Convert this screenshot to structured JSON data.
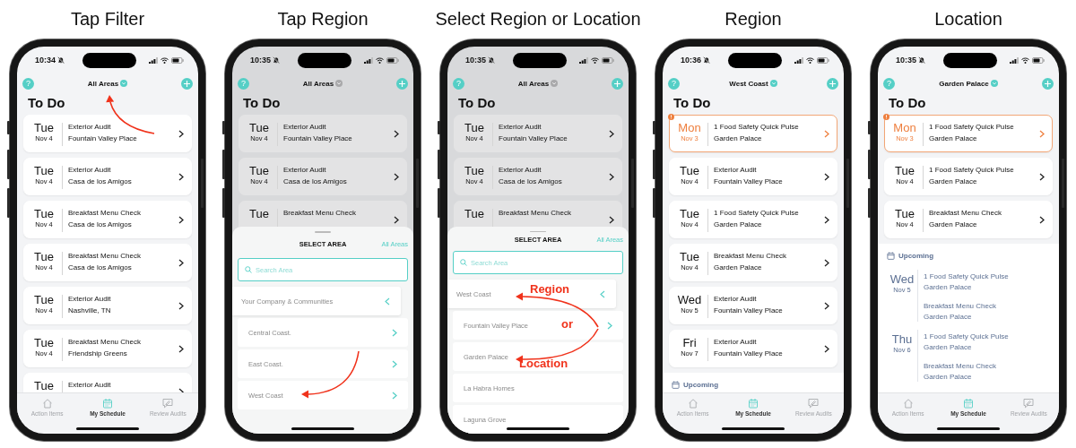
{
  "panels": [
    {
      "caption": "Tap Filter",
      "phone": {
        "time": "10:34",
        "header": {
          "help": "?",
          "title": "All Areas",
          "dropdown_open": false
        },
        "heading": "To Do",
        "cards": [
          {
            "day": "Tue",
            "date": "Nov 4",
            "title": "Exterior Audit",
            "place": "Fountain Valley Place",
            "overdue": false
          },
          {
            "day": "Tue",
            "date": "Nov 4",
            "title": "Exterior Audit",
            "place": "Casa de los Amigos",
            "overdue": false
          },
          {
            "day": "Tue",
            "date": "Nov 4",
            "title": "Breakfast Menu Check",
            "place": "Casa de los Amigos",
            "overdue": false
          },
          {
            "day": "Tue",
            "date": "Nov 4",
            "title": "Breakfast Menu Check",
            "place": "Casa de los Amigos",
            "overdue": false
          },
          {
            "day": "Tue",
            "date": "Nov 4",
            "title": "Exterior Audit",
            "place": "Nashville, TN",
            "overdue": false
          },
          {
            "day": "Tue",
            "date": "Nov 4",
            "title": "Breakfast Menu Check",
            "place": "Friendship Greens",
            "overdue": false
          },
          {
            "day": "Tue",
            "title": "Exterior Audit",
            "overdue": false
          }
        ],
        "tabs": [
          {
            "label": "Action Items",
            "selected": false
          },
          {
            "label": "My Schedule",
            "selected": true
          },
          {
            "label": "Review Audits",
            "selected": false
          }
        ]
      },
      "annotation": {
        "kind": "title-arrow"
      }
    },
    {
      "caption": "Tap Region",
      "phone": {
        "time": "10:35",
        "header": {
          "help": "?",
          "title": "All Areas",
          "dropdown_open": true
        },
        "heading": "To Do",
        "cards": [
          {
            "day": "Tue",
            "date": "Nov 4",
            "title": "Exterior Audit",
            "place": "Fountain Valley Place",
            "overdue": false
          },
          {
            "day": "Tue",
            "date": "Nov 4",
            "title": "Exterior Audit",
            "place": "Casa de los Amigos",
            "overdue": false
          },
          {
            "day": "Tue",
            "title": "Breakfast Menu Check",
            "overdue": false
          }
        ],
        "sheet": {
          "title": "SELECT AREA",
          "reset": "All Areas",
          "search_placeholder": "Search Area",
          "rows": [
            {
              "kind": "back",
              "label": "Your Company & Communities"
            },
            {
              "kind": "group",
              "label": "Central Coast."
            },
            {
              "kind": "group",
              "label": "East Coast."
            },
            {
              "kind": "group",
              "label": "West Coast"
            }
          ]
        }
      },
      "annotation": {
        "kind": "row-arrow"
      }
    },
    {
      "caption": "Select Region or Location",
      "phone": {
        "time": "10:35",
        "header": {
          "help": "?",
          "title": "All Areas",
          "dropdown_open": true
        },
        "heading": "To Do",
        "cards": [
          {
            "day": "Tue",
            "date": "Nov 4",
            "title": "Exterior Audit",
            "place": "Fountain Valley Place",
            "overdue": false
          },
          {
            "day": "Tue",
            "date": "Nov 4",
            "title": "Exterior Audit",
            "place": "Casa de los Amigos",
            "overdue": false
          },
          {
            "day": "Tue",
            "title": "Breakfast Menu Check",
            "overdue": false
          }
        ],
        "sheet": {
          "title": "SELECT AREA",
          "reset": "All Areas",
          "search_placeholder": "Search Area",
          "rows": [
            {
              "kind": "back",
              "label": "West Coast"
            },
            {
              "kind": "group",
              "label": "Fountain Valley Place"
            },
            {
              "kind": "location",
              "label": "Garden Palace"
            },
            {
              "kind": "location",
              "label": "La Habra Homes"
            },
            {
              "kind": "location",
              "label": "Laguna Grove"
            }
          ]
        }
      },
      "annotation": {
        "kind": "split-arrows",
        "labels": [
          "Region",
          "or",
          "Location"
        ]
      }
    },
    {
      "caption": "Region",
      "phone": {
        "time": "10:36",
        "header": {
          "help": "?",
          "title": "West Coast",
          "dropdown_open": false
        },
        "heading": "To Do",
        "cards": [
          {
            "day": "Mon",
            "date": "Nov 3",
            "title": "1 Food Safety Quick Pulse",
            "place": "Garden Palace",
            "overdue": true
          },
          {
            "day": "Tue",
            "date": "Nov 4",
            "title": "Exterior Audit",
            "place": "Fountain Valley Place",
            "overdue": false
          },
          {
            "day": "Tue",
            "date": "Nov 4",
            "title": "1 Food Safety Quick Pulse",
            "place": "Garden Palace",
            "overdue": false
          },
          {
            "day": "Tue",
            "date": "Nov 4",
            "title": "Breakfast Menu Check",
            "place": "Garden Palace",
            "overdue": false
          },
          {
            "day": "Wed",
            "date": "Nov 5",
            "title": "Exterior Audit",
            "place": "Fountain Valley Place",
            "overdue": false
          },
          {
            "day": "Fri",
            "date": "Nov 7",
            "title": "Exterior Audit",
            "place": "Fountain Valley Place",
            "overdue": false
          }
        ],
        "upcoming": {
          "label": "Upcoming"
        },
        "tabs": [
          {
            "label": "Action Items",
            "selected": false
          },
          {
            "label": "My Schedule",
            "selected": true
          },
          {
            "label": "Review Audits",
            "selected": false
          }
        ]
      }
    },
    {
      "caption": "Location",
      "phone": {
        "time": "10:35",
        "header": {
          "help": "?",
          "title": "Garden Palace",
          "dropdown_open": false
        },
        "heading": "To Do",
        "cards": [
          {
            "day": "Mon",
            "date": "Nov 3",
            "title": "1 Food Safety Quick Pulse",
            "place": "Garden Palace",
            "overdue": true
          },
          {
            "day": "Tue",
            "date": "Nov 4",
            "title": "1 Food Safety Quick Pulse",
            "place": "Garden Palace",
            "overdue": false
          },
          {
            "day": "Tue",
            "date": "Nov 4",
            "title": "Breakfast Menu Check",
            "place": "Garden Palace",
            "overdue": false
          }
        ],
        "upcoming": {
          "label": "Upcoming",
          "groups": [
            {
              "day": "Wed",
              "date": "Nov 5",
              "items": [
                {
                  "title": "1 Food Safety Quick Pulse",
                  "place": "Garden Palace"
                },
                {
                  "title": "Breakfast Menu Check",
                  "place": "Garden Palace"
                }
              ]
            },
            {
              "day": "Thu",
              "date": "Nov 6",
              "items": [
                {
                  "title": "1 Food Safety Quick Pulse",
                  "place": "Garden Palace"
                },
                {
                  "title": "Breakfast Menu Check",
                  "place": "Garden Palace"
                }
              ]
            }
          ]
        },
        "tabs": [
          {
            "label": "Action Items",
            "selected": false
          },
          {
            "label": "My Schedule",
            "selected": true
          },
          {
            "label": "Review Audits",
            "selected": false
          }
        ]
      }
    }
  ]
}
